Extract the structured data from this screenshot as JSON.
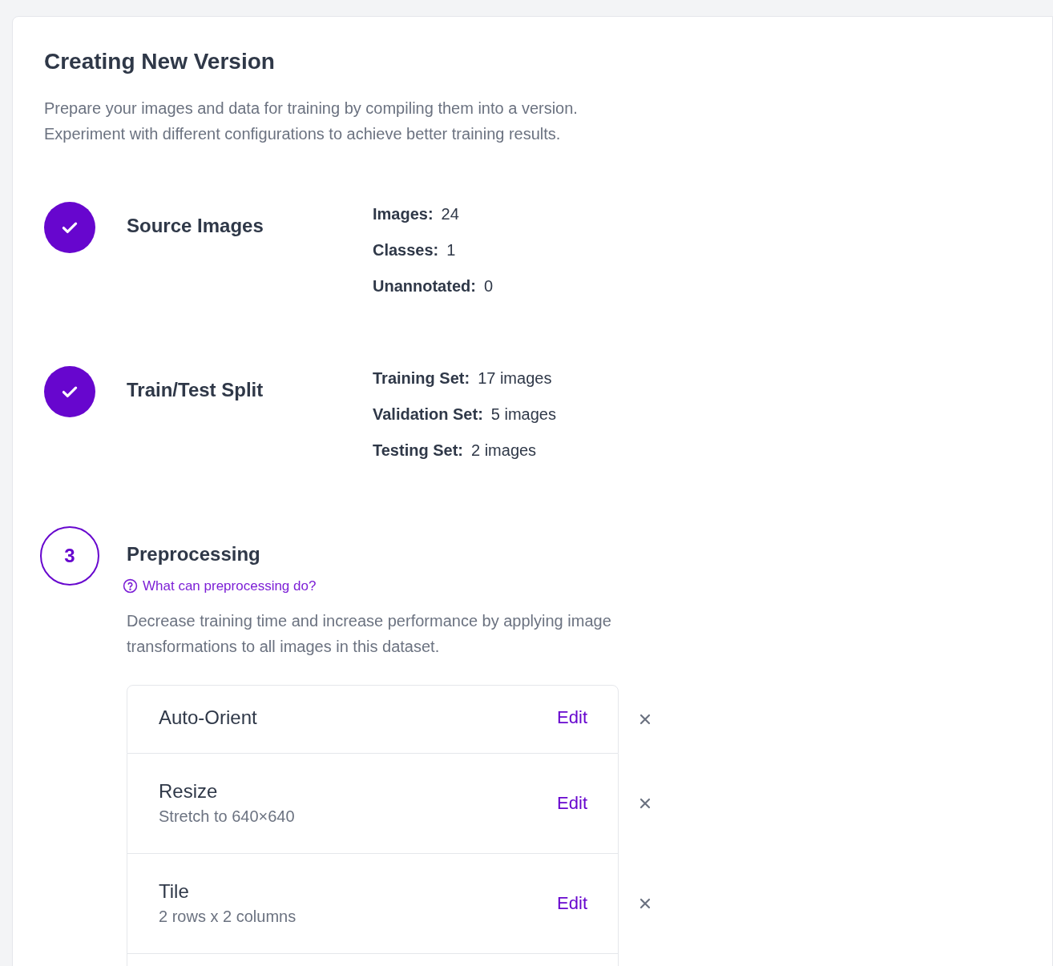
{
  "title": "Creating New Version",
  "description": [
    "Prepare your images and data for training by compiling them into a version.",
    "Experiment with different configurations to achieve better training results."
  ],
  "steps": [
    {
      "done": true,
      "title": "Source Images",
      "stats": [
        {
          "label": "Images:",
          "value": "24"
        },
        {
          "label": "Classes:",
          "value": "1"
        },
        {
          "label": "Unannotated:",
          "value": "0"
        }
      ]
    },
    {
      "done": true,
      "title": "Train/Test Split",
      "stats": [
        {
          "label": "Training Set:",
          "value": "17 images"
        },
        {
          "label": "Validation Set:",
          "value": "5 images"
        },
        {
          "label": "Testing Set:",
          "value": "2 images"
        }
      ]
    },
    {
      "marker": "3",
      "done": false,
      "title": "Preprocessing",
      "help_link": "What can preprocessing do?",
      "description": [
        "Decrease training time and increase performance by applying image",
        "transformations to all images in this dataset."
      ],
      "options": [
        {
          "name": "Auto-Orient",
          "edit": "Edit"
        },
        {
          "name": "Resize",
          "detail": "Stretch to 640×640",
          "edit": "Edit"
        },
        {
          "name": "Tile",
          "detail": "2 rows x 2 columns",
          "edit": "Edit"
        }
      ]
    }
  ]
}
